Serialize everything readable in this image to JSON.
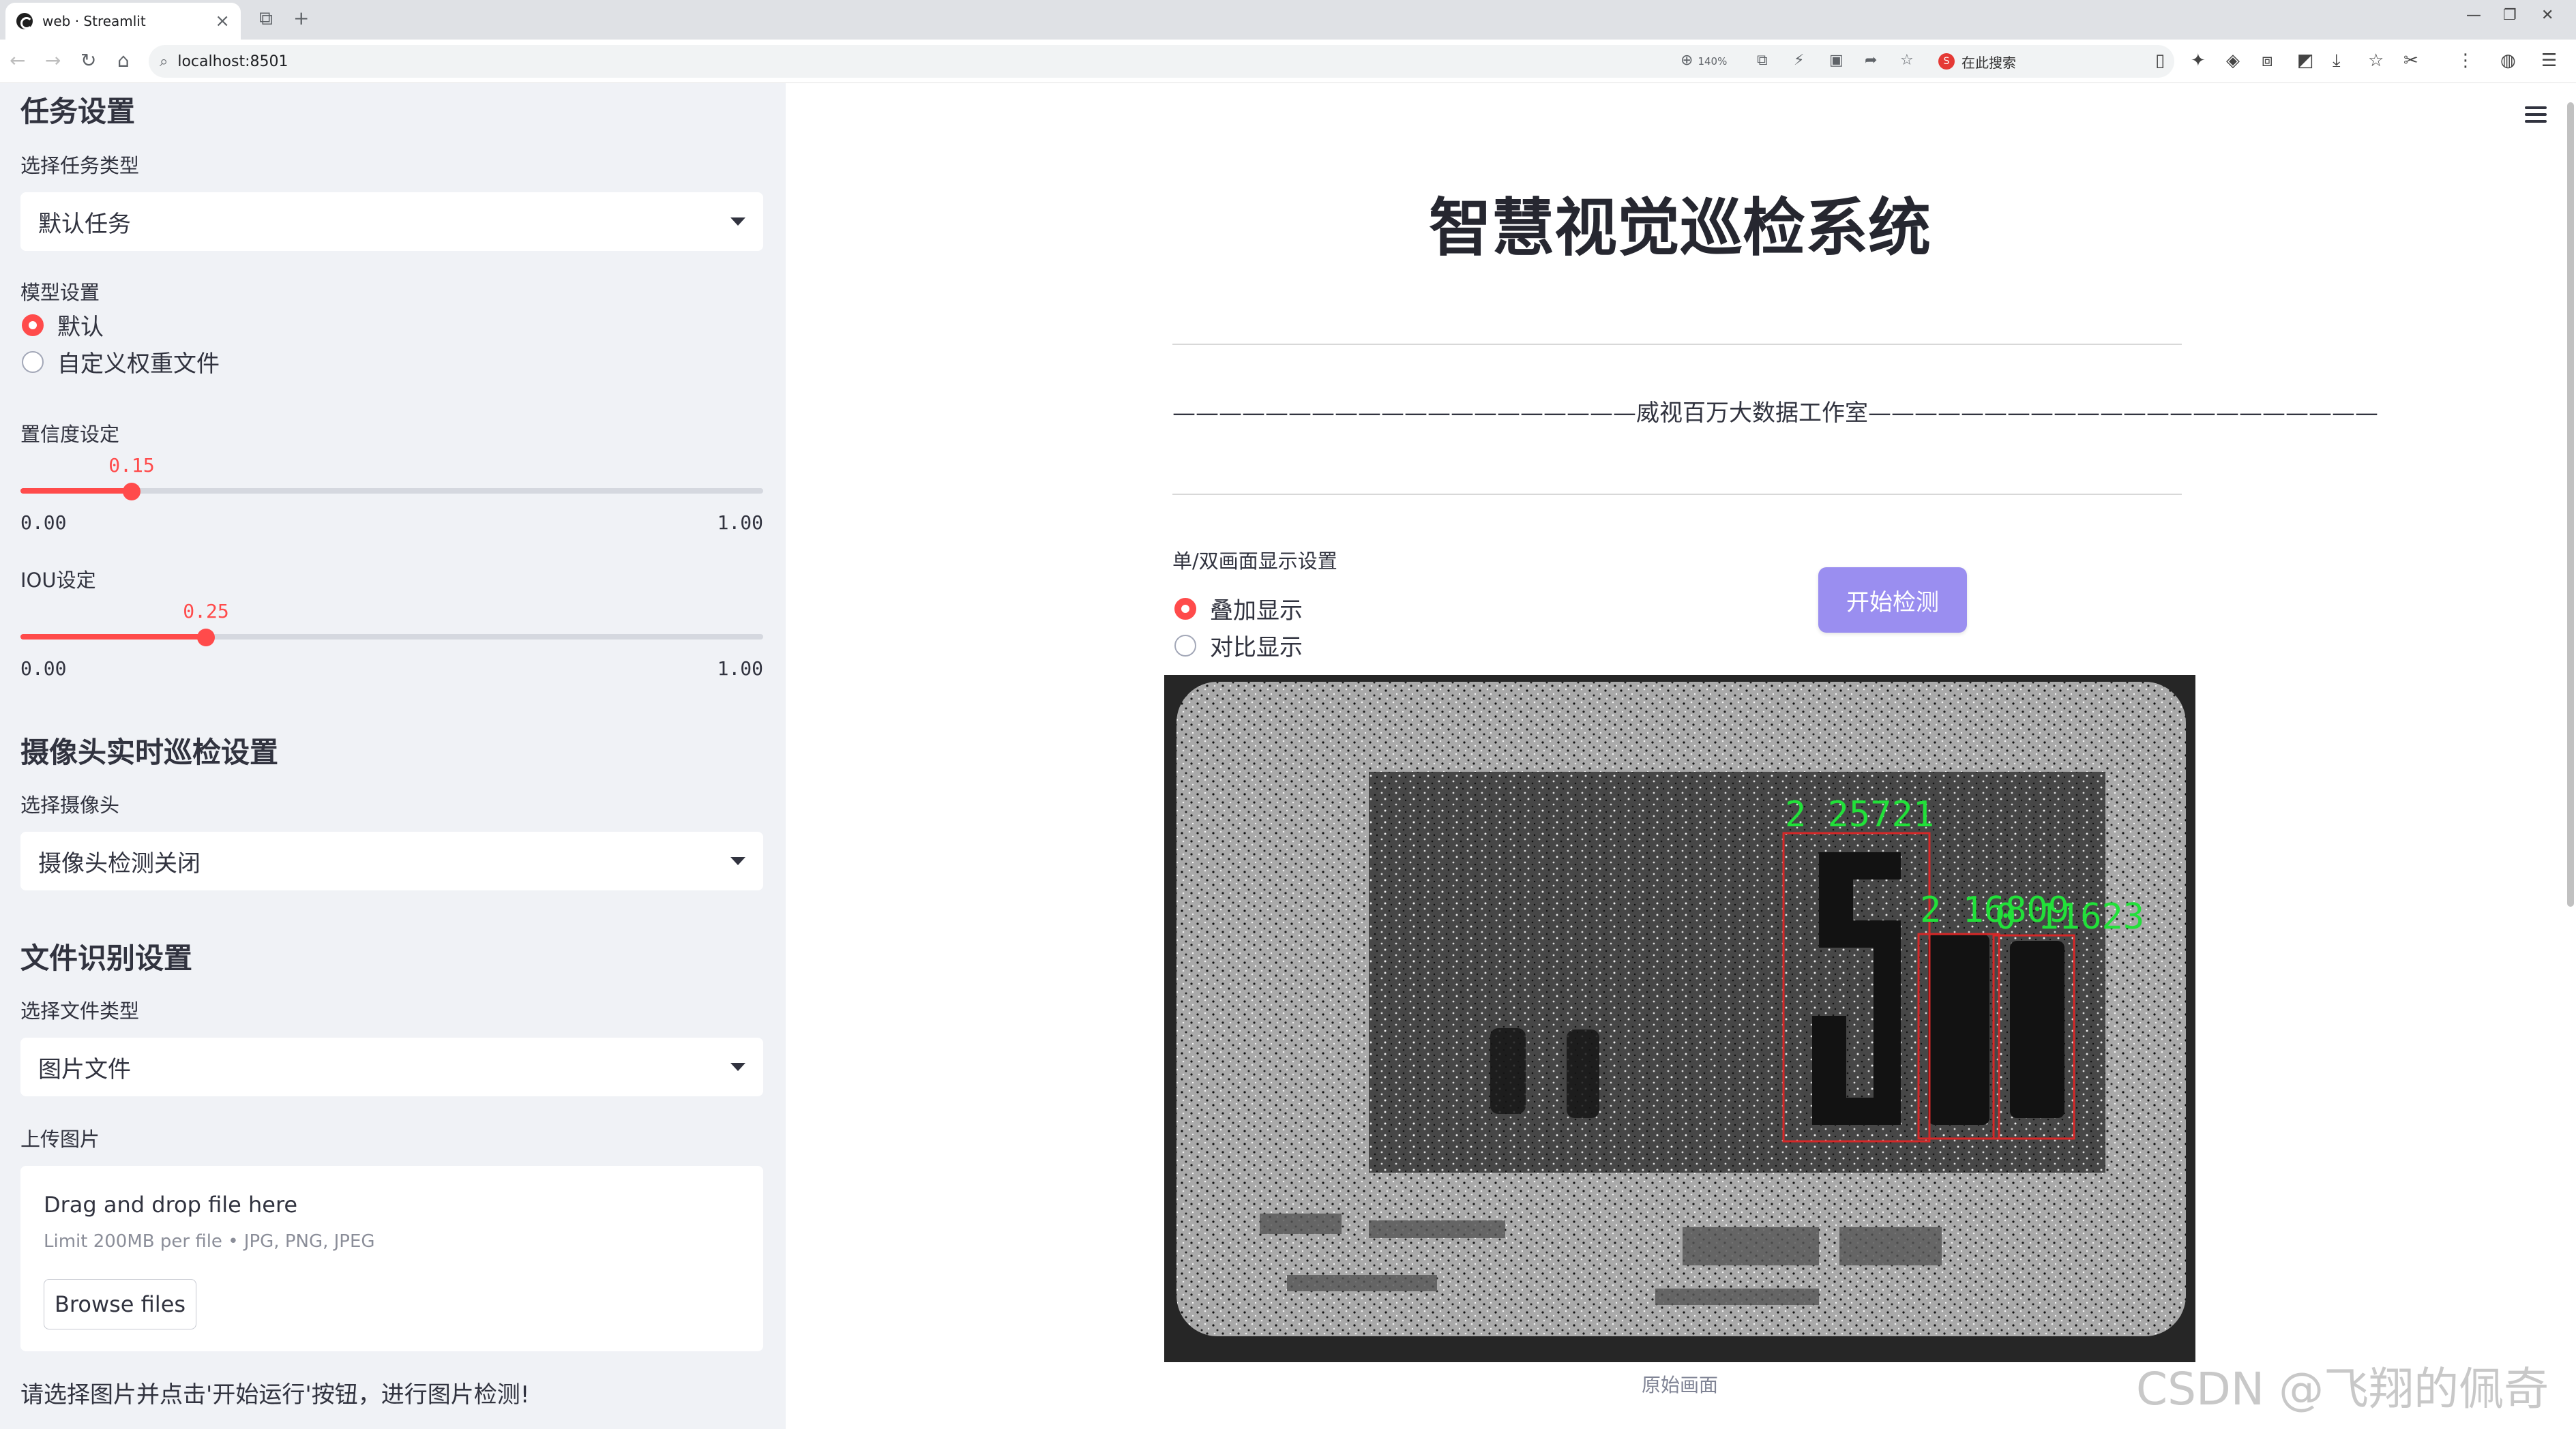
{
  "browser": {
    "tab_title": "web · Streamlit",
    "url": "localhost:8501",
    "zoom": "140%",
    "search_placeholder": "在此搜索",
    "search_engine_glyph": "S"
  },
  "sidebar": {
    "task_section_title": "任务设置",
    "task_type_label": "选择任务类型",
    "task_type_value": "默认任务",
    "model_label": "模型设置",
    "model_options": [
      "默认",
      "自定义权重文件"
    ],
    "model_selected": 0,
    "conf_label": "置信度设定",
    "conf_value": "0.15",
    "conf_fraction": 0.15,
    "conf_min": "0.00",
    "conf_max": "1.00",
    "iou_label": "IOU设定",
    "iou_value": "0.25",
    "iou_fraction": 0.25,
    "iou_min": "0.00",
    "iou_max": "1.00",
    "camera_section_title": "摄像头实时巡检设置",
    "camera_label": "选择摄像头",
    "camera_value": "摄像头检测关闭",
    "file_section_title": "文件识别设置",
    "file_type_label": "选择文件类型",
    "file_type_value": "图片文件",
    "upload_label": "上传图片",
    "upload_drag_text": "Drag and drop file here",
    "upload_limit_text": "Limit 200MB per file • JPG, PNG, JPEG",
    "browse_button": "Browse files",
    "hint": "请选择图片并点击'开始运行'按钮，进行图片检测!"
  },
  "main": {
    "title": "智慧视觉巡检系统",
    "subtitle": "————————————————————威视百万大数据工作室——————————————————————",
    "display_label": "单/双画面显示设置",
    "display_options": [
      "叠加显示",
      "对比显示"
    ],
    "display_selected": 0,
    "start_button": "开始检测",
    "image_caption": "原始画面",
    "detections": [
      {
        "label": "2 25721"
      },
      {
        "label": "2 16809"
      },
      {
        "label": "0 11623"
      }
    ]
  },
  "watermark": "CSDN @飞翔的佩奇",
  "colors": {
    "accent": "#ff4b4b",
    "sidebar_bg": "#f0f2f6",
    "button": "#9a8ef0",
    "detection_box": "#d62828",
    "detection_text": "#22e03a"
  }
}
